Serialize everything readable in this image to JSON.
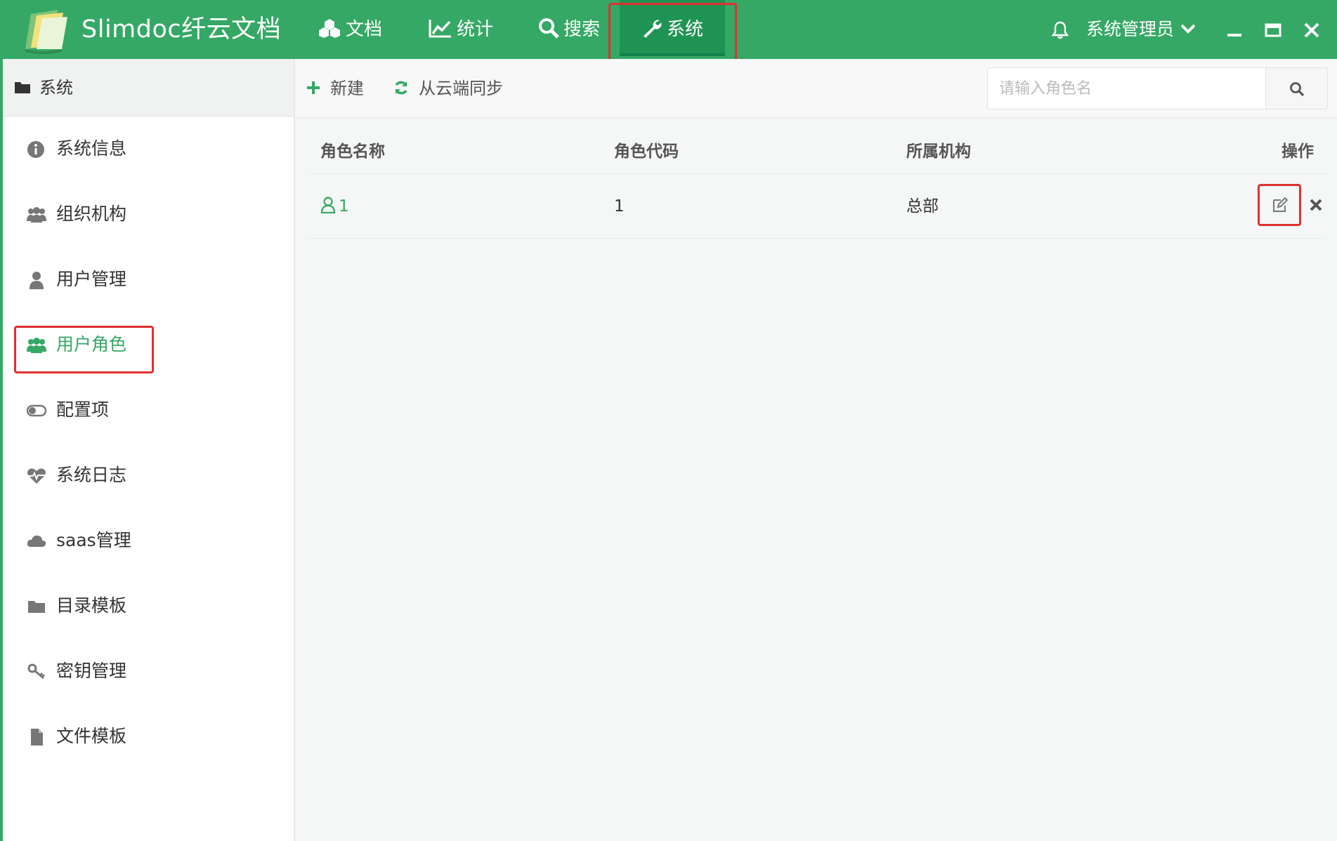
{
  "header": {
    "brand": "Slimdoc纤云文档",
    "nav": [
      {
        "label": "文档",
        "icon": "cubes-icon"
      },
      {
        "label": "统计",
        "icon": "line-chart-icon"
      },
      {
        "label": "搜索",
        "icon": "search-icon"
      },
      {
        "label": "系统",
        "icon": "wrench-icon",
        "active": true
      }
    ],
    "user": "系统管理员",
    "colors": {
      "bar": "#35a865",
      "active": "#1f9353"
    }
  },
  "sidebar": {
    "title": "系统",
    "items": [
      {
        "label": "系统信息",
        "icon": "info-circle-icon"
      },
      {
        "label": "组织机构",
        "icon": "users-icon"
      },
      {
        "label": "用户管理",
        "icon": "user-icon"
      },
      {
        "label": "用户角色",
        "icon": "users-icon",
        "active": true
      },
      {
        "label": "配置项",
        "icon": "toggle-icon"
      },
      {
        "label": "系统日志",
        "icon": "heartbeat-icon"
      },
      {
        "label": "saas管理",
        "icon": "cloud-icon"
      },
      {
        "label": "目录模板",
        "icon": "folder-icon"
      },
      {
        "label": "密钥管理",
        "icon": "key-icon"
      },
      {
        "label": "文件模板",
        "icon": "file-icon"
      }
    ]
  },
  "toolbar": {
    "new_label": "新建",
    "sync_label": "从云端同步",
    "search_placeholder": "请输入角色名"
  },
  "table": {
    "columns": [
      "角色名称",
      "角色代码",
      "所属机构",
      "操作"
    ],
    "rows": [
      {
        "name": "1",
        "code": "1",
        "org": "总部"
      }
    ]
  }
}
